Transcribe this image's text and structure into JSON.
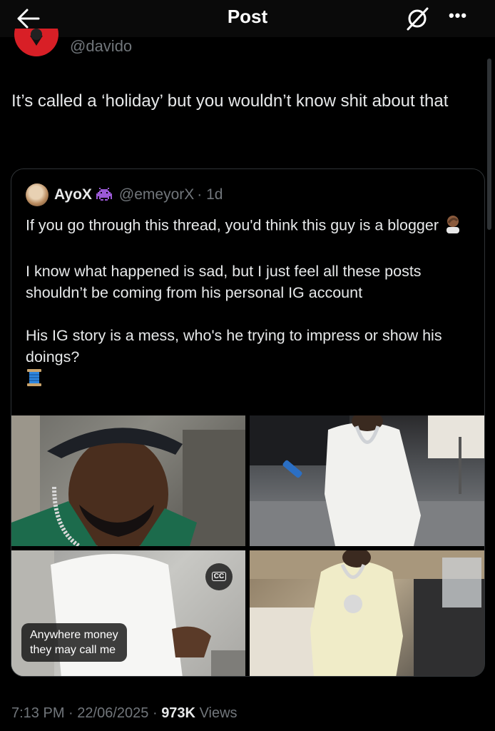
{
  "header": {
    "title": "Post",
    "back_icon": "back-arrow-icon",
    "grok_icon": "grok-icon",
    "more_icon": "more-horizontal-icon",
    "more_label": "•••"
  },
  "author": {
    "handle": "@davido"
  },
  "post": {
    "text": "It’s called a ‘holiday’ but you wouldn’t know shit about that"
  },
  "quote": {
    "name": "AyoX",
    "badge_icon": "alien-monster-icon",
    "handle": "@emeyorX",
    "time": "· 1d",
    "line1": "If you go through this thread, you'd think this guy is a blogger",
    "line2": "I know what happened is sad, but I just feel all these posts shouldn’t be coming from his personal IG account",
    "line3": "His IG story is a mess, who's he trying to impress or show his doings?",
    "emoji1": "person-facepalming-emoji",
    "emoji2": "spool-of-thread-emoji",
    "media": {
      "cc_label": "CC",
      "caption": "Anywhere money\nthey may call me"
    }
  },
  "footer": {
    "time": "7:13 PM",
    "sep1": "·",
    "date": "22/06/2025",
    "sep2": "·",
    "views_count": "973K",
    "views_label": "Views"
  },
  "colors": {
    "background": "#000000",
    "text": "#e7e9ea",
    "secondary": "#71767b",
    "border": "#2f3336"
  }
}
